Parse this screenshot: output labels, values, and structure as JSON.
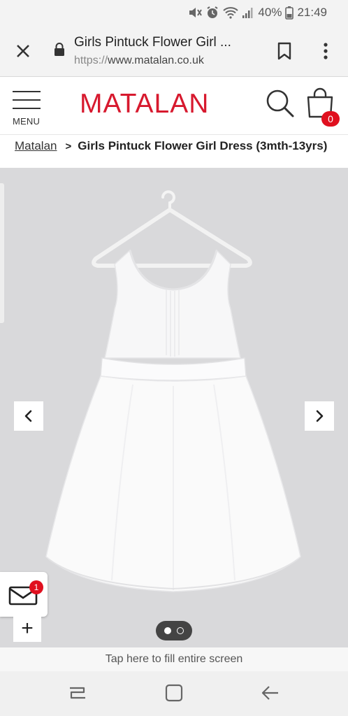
{
  "status_bar": {
    "battery": "40%",
    "time": "21:49",
    "icons": [
      "mute-icon",
      "alarm-icon",
      "wifi-icon",
      "signal-icon",
      "battery-icon"
    ]
  },
  "browser": {
    "page_title": "Girls Pintuck Flower Girl ...",
    "url_scheme": "https://",
    "url_host": "www.matalan.co.uk",
    "icons": [
      "close-icon",
      "lock-icon",
      "bookmark-icon",
      "more-vert-icon"
    ]
  },
  "header": {
    "menu_label": "MENU",
    "logo": "MATALAN",
    "bag_count": "0",
    "brand_color": "#d7192e",
    "icons": [
      "hamburger-icon",
      "search-icon",
      "bag-icon"
    ]
  },
  "breadcrumb": {
    "home": "Matalan",
    "separator": ">",
    "current": "Girls Pintuck Flower Girl Dress (3mth-13yrs)"
  },
  "gallery": {
    "image_alt": "White sleeveless flower girl dress on hanger",
    "total_images": 2,
    "active_index": 0,
    "mail_badge": "1",
    "plus_label": "+",
    "icons": [
      "chevron-left-icon",
      "chevron-right-icon",
      "mail-icon",
      "plus-icon"
    ]
  },
  "hint": {
    "text": "Tap here to fill entire screen"
  },
  "navbar": {
    "icons": [
      "recent-apps-icon",
      "home-icon",
      "back-icon"
    ]
  }
}
